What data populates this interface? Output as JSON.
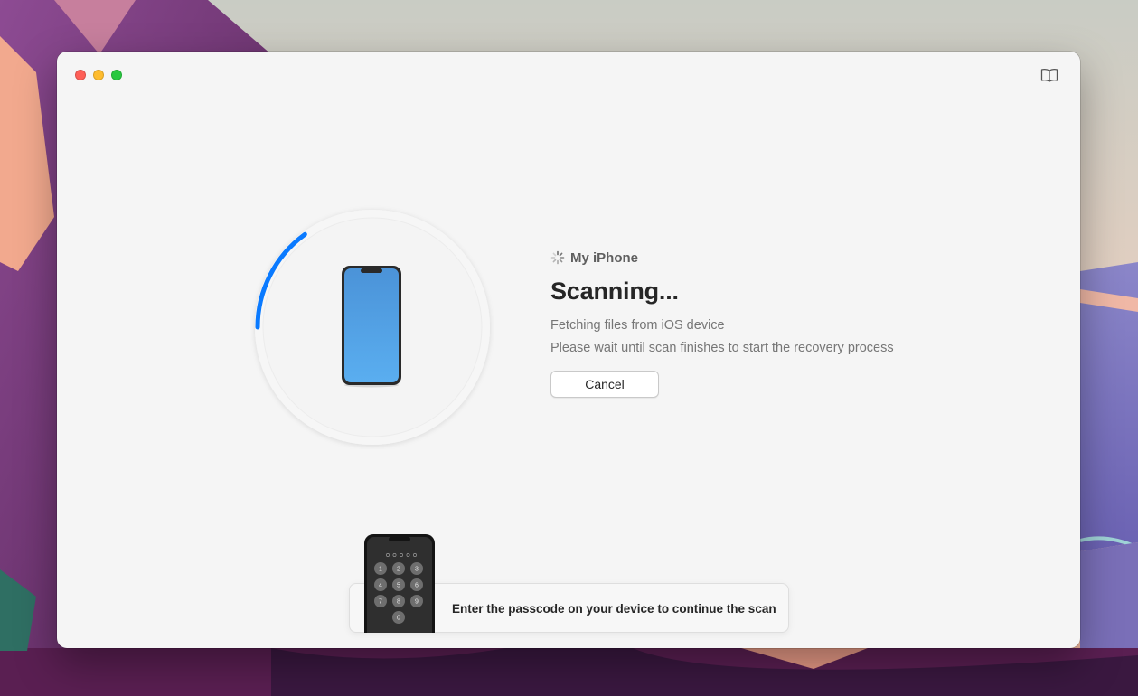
{
  "window": {
    "device_name": "My iPhone",
    "status_title": "Scanning...",
    "status_line_1": "Fetching files from iOS device",
    "status_line_2": "Please wait until scan finishes to start the recovery process",
    "cancel_label": "Cancel",
    "progress_fraction": 0.15,
    "accent_color": "#0a7aff",
    "passcode_prompt": "Enter the passcode on your device to continue the scan",
    "keypad_digits": [
      "1",
      "2",
      "3",
      "4",
      "5",
      "6",
      "7",
      "8",
      "9",
      "0"
    ]
  },
  "icons": {
    "window_controls": [
      "close-icon",
      "minimize-icon",
      "zoom-icon"
    ],
    "toolbar": "book-icon",
    "status": "spinner-icon"
  }
}
